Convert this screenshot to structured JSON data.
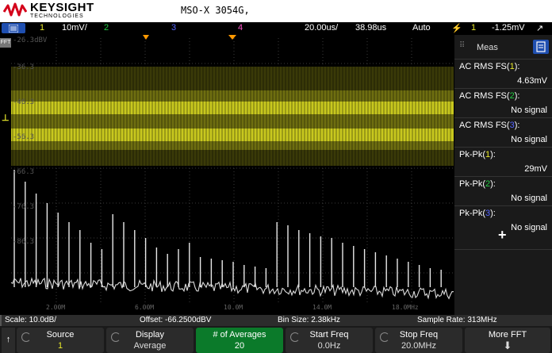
{
  "header": {
    "brand": "KEYSIGHT",
    "brand_sub": "TECHNOLOGIES",
    "model": "MSO-X 3054G,"
  },
  "channel_bar": {
    "ch1": "1",
    "ch1_scale": "10mV/",
    "ch2": "2",
    "ch3": "3",
    "ch4": "4",
    "timebase": "20.00us/",
    "delay": "38.98us",
    "trigger_mode": "Auto",
    "trigger_src": "1",
    "trigger_level": "-1.25mV"
  },
  "plot": {
    "fft_tag": "FFT",
    "y_labels": [
      "-26.3dBV",
      "-36.3",
      "-46.3",
      "-56.3",
      "-66.3",
      "-76.3",
      "-86.3"
    ],
    "x_labels": [
      "2.00M",
      "6.00M",
      "10.0M",
      "14.0M",
      "18.0MHz"
    ]
  },
  "meas_panel": {
    "title": "Meas",
    "items": [
      {
        "name": "AC RMS FS(",
        "ch": "1",
        "close": "):",
        "value": "4.63mV"
      },
      {
        "name": "AC RMS FS(",
        "ch": "2",
        "close": "):",
        "value": "No signal"
      },
      {
        "name": "AC RMS FS(",
        "ch": "3",
        "close": "):",
        "value": "No signal"
      },
      {
        "name": "Pk-Pk(",
        "ch": "1",
        "close": "):",
        "value": "29mV"
      },
      {
        "name": "Pk-Pk(",
        "ch": "2",
        "close": "):",
        "value": "No signal"
      },
      {
        "name": "Pk-Pk(",
        "ch": "3",
        "close": "):",
        "value": "No signal"
      }
    ],
    "add_label": "+"
  },
  "status": {
    "scale": "Scale: 10.0dB/",
    "offset": "Offset: -66.2500dBV",
    "bin": "Bin Size: 2.38kHz",
    "rate": "Sample Rate: 313MHz"
  },
  "softkeys": [
    {
      "label": "Source",
      "value": "1"
    },
    {
      "label": "Display",
      "value": "Average"
    },
    {
      "label": "# of Averages",
      "value": "20"
    },
    {
      "label": "Start Freq",
      "value": "0.0Hz"
    },
    {
      "label": "Stop Freq",
      "value": "20.0MHz"
    },
    {
      "label": "More FFT",
      "value": ""
    }
  ],
  "colors": {
    "ch1": "#e8e82a",
    "ch2": "#22cc44",
    "ch3": "#5566ff",
    "ch4": "#ff55cc",
    "active_key": "#0b7a2a",
    "accent": "#1f4fb0"
  }
}
